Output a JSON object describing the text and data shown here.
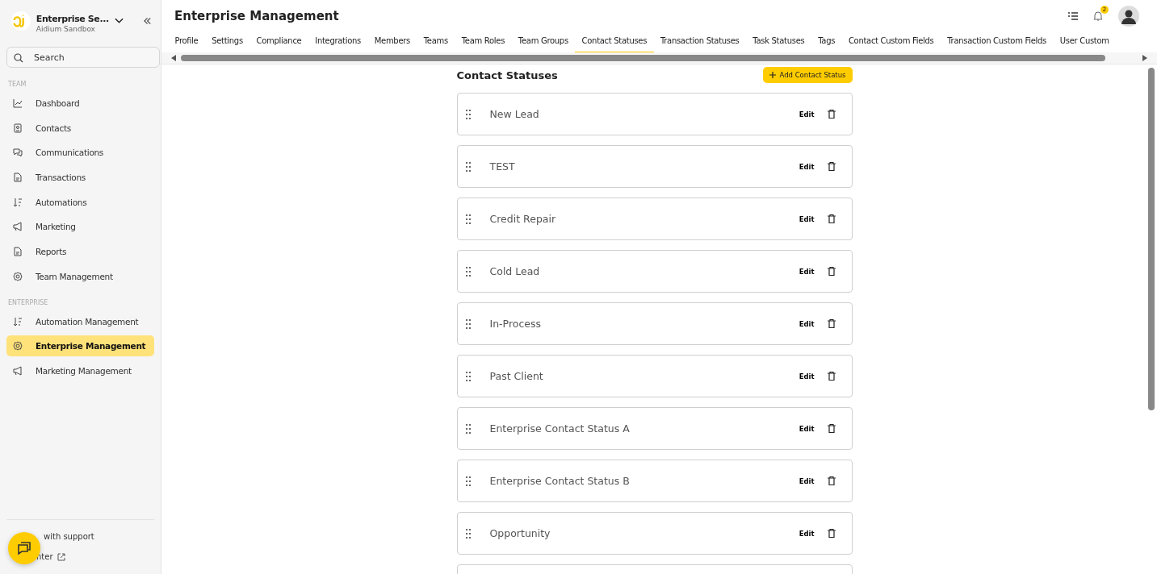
{
  "workspace": {
    "name": "Enterprise Se...",
    "subtitle": "Aidium Sandbox"
  },
  "search": {
    "placeholder": "Search"
  },
  "nav_sections": [
    {
      "heading": "TEAM",
      "items": [
        {
          "label": "Dashboard",
          "selected": false
        },
        {
          "label": "Contacts",
          "selected": false
        },
        {
          "label": "Communications",
          "selected": false
        },
        {
          "label": "Transactions",
          "selected": false
        },
        {
          "label": "Automations",
          "selected": false
        },
        {
          "label": "Marketing",
          "selected": false
        },
        {
          "label": "Reports",
          "selected": false
        },
        {
          "label": "Team Management",
          "selected": false
        }
      ]
    },
    {
      "heading": "ENTERPRISE",
      "items": [
        {
          "label": "Automation Management",
          "selected": false
        },
        {
          "label": "Enterprise Management",
          "selected": true
        },
        {
          "label": "Marketing Management",
          "selected": false
        }
      ]
    }
  ],
  "footer": {
    "support": "with support",
    "help": "nter"
  },
  "page_title": "Enterprise Management",
  "notification_count": "2",
  "tabs": [
    {
      "label": "Profile",
      "selected": false
    },
    {
      "label": "Settings",
      "selected": false
    },
    {
      "label": "Compliance",
      "selected": false
    },
    {
      "label": "Integrations",
      "selected": false
    },
    {
      "label": "Members",
      "selected": false
    },
    {
      "label": "Teams",
      "selected": false
    },
    {
      "label": "Team Roles",
      "selected": false
    },
    {
      "label": "Team Groups",
      "selected": false
    },
    {
      "label": "Contact Statuses",
      "selected": true
    },
    {
      "label": "Transaction Statuses",
      "selected": false
    },
    {
      "label": "Task Statuses",
      "selected": false
    },
    {
      "label": "Tags",
      "selected": false
    },
    {
      "label": "Contact Custom Fields",
      "selected": false
    },
    {
      "label": "Transaction Custom Fields",
      "selected": false
    },
    {
      "label": "User Custom",
      "selected": false
    }
  ],
  "section_title": "Contact Statuses",
  "add_button": "Add Contact Status",
  "statuses": [
    {
      "name": "New Lead",
      "edit": "Edit"
    },
    {
      "name": "TEST",
      "edit": "Edit"
    },
    {
      "name": "Credit Repair",
      "edit": "Edit"
    },
    {
      "name": "Cold Lead",
      "edit": "Edit"
    },
    {
      "name": "In-Process",
      "edit": "Edit"
    },
    {
      "name": "Past Client",
      "edit": "Edit"
    },
    {
      "name": "Enterprise Contact Status A",
      "edit": "Edit"
    },
    {
      "name": "Enterprise Contact Status B",
      "edit": "Edit"
    },
    {
      "name": "Opportunity",
      "edit": "Edit"
    }
  ]
}
